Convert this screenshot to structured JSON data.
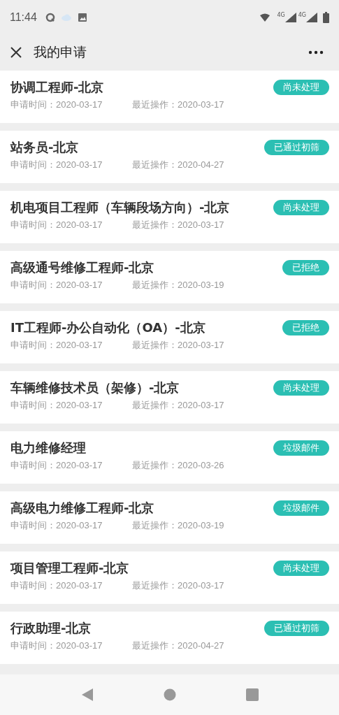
{
  "status_bar": {
    "time": "11:44",
    "network_labels": [
      "4G",
      "4G"
    ]
  },
  "header": {
    "title": "我的申请"
  },
  "applications": [
    {
      "title": "协调工程师-北京",
      "status": "尚未处理",
      "applied": "申请时间：2020-03-17",
      "last_action": "最近操作：2020-03-17"
    },
    {
      "title": "站务员-北京",
      "status": "已通过初筛",
      "applied": "申请时间：2020-03-17",
      "last_action": "最近操作：2020-04-27"
    },
    {
      "title": "机电项目工程师（车辆段场方向）-北京",
      "status": "尚未处理",
      "applied": "申请时间：2020-03-17",
      "last_action": "最近操作：2020-03-17"
    },
    {
      "title": "高级通号维修工程师-北京",
      "status": "已拒绝",
      "applied": "申请时间：2020-03-17",
      "last_action": "最近操作：2020-03-19"
    },
    {
      "title": "IT工程师-办公自动化（OA）-北京",
      "status": "已拒绝",
      "applied": "申请时间：2020-03-17",
      "last_action": "最近操作：2020-03-17"
    },
    {
      "title": "车辆维修技术员（架修）-北京",
      "status": "尚未处理",
      "applied": "申请时间：2020-03-17",
      "last_action": "最近操作：2020-03-17"
    },
    {
      "title": "电力维修经理",
      "status": "垃圾邮件",
      "applied": "申请时间：2020-03-17",
      "last_action": "最近操作：2020-03-26"
    },
    {
      "title": "高级电力维修工程师-北京",
      "status": "垃圾邮件",
      "applied": "申请时间：2020-03-17",
      "last_action": "最近操作：2020-03-19"
    },
    {
      "title": "项目管理工程师-北京",
      "status": "尚未处理",
      "applied": "申请时间：2020-03-17",
      "last_action": "最近操作：2020-03-17"
    },
    {
      "title": "行政助理-北京",
      "status": "已通过初筛",
      "applied": "申请时间：2020-03-17",
      "last_action": "最近操作：2020-04-27"
    }
  ]
}
